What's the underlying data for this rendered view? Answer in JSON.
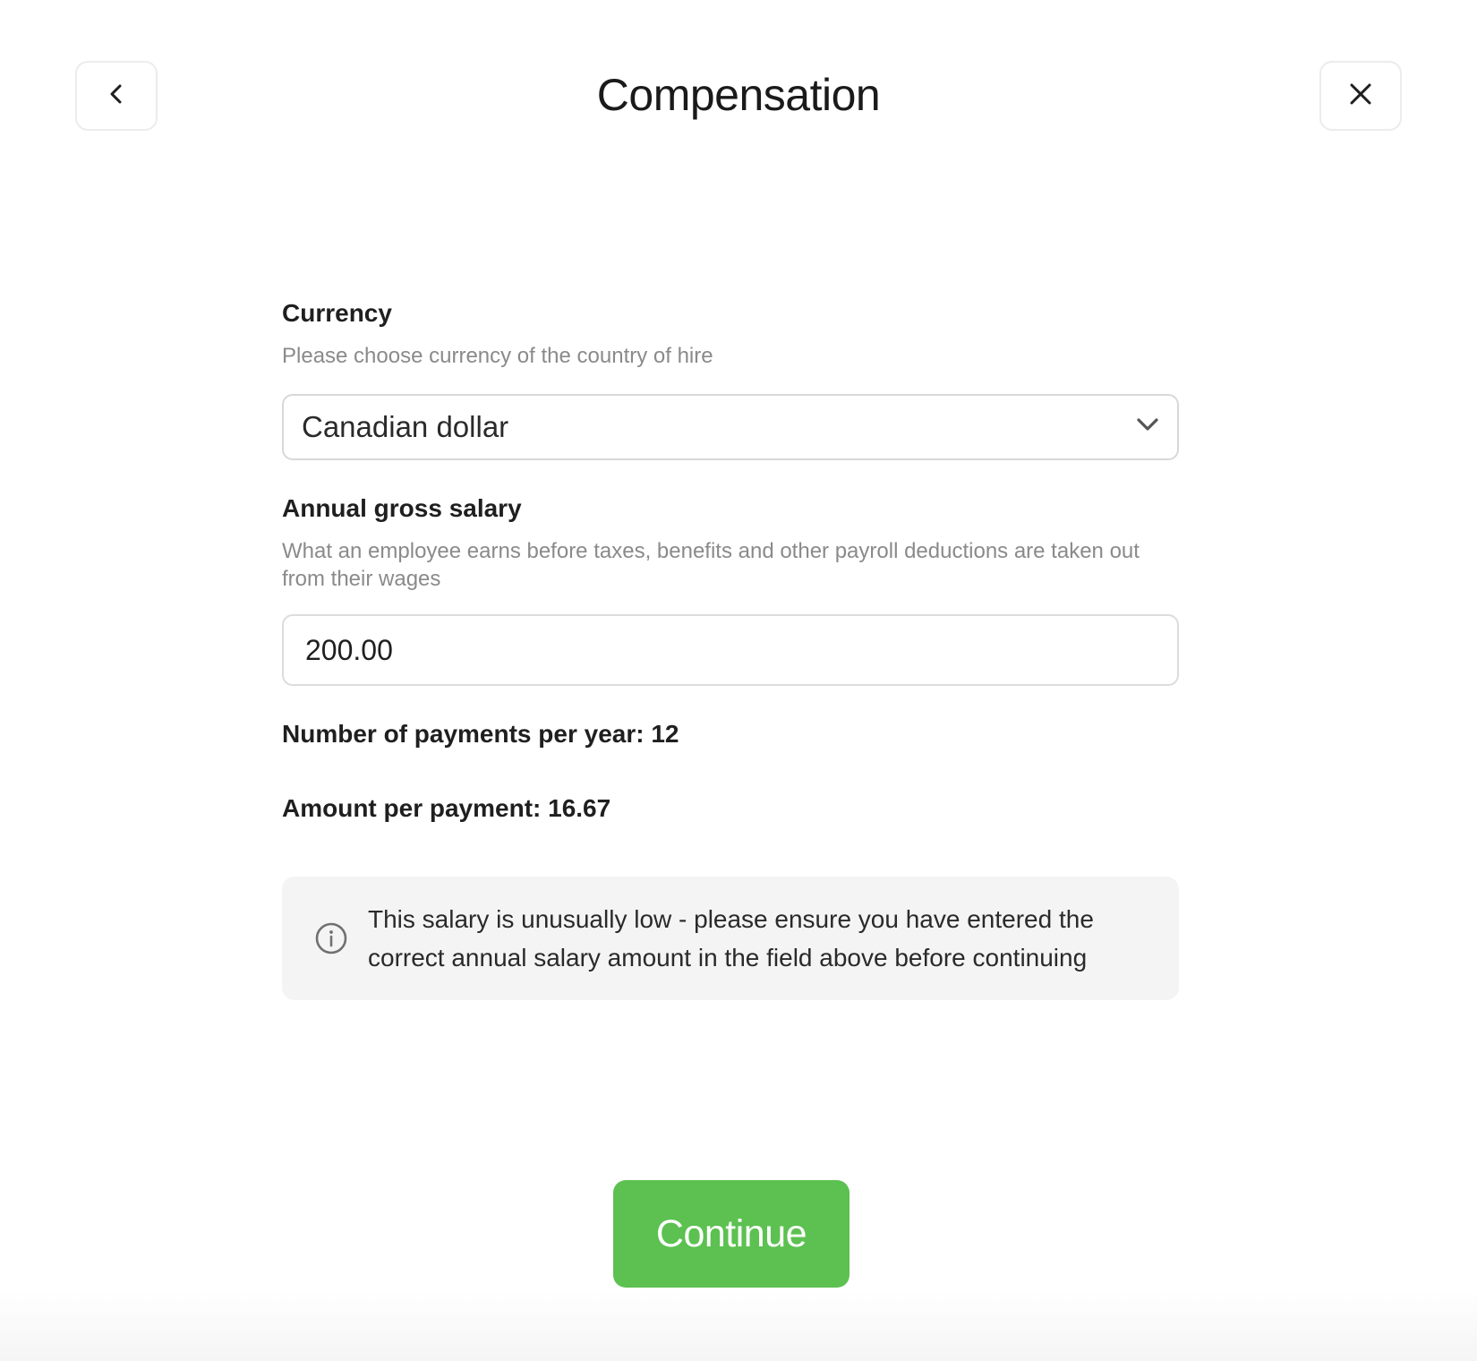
{
  "header": {
    "title": "Compensation",
    "back_icon": "chevron-left-icon",
    "close_icon": "close-icon"
  },
  "currency": {
    "label": "Currency",
    "help": "Please choose currency of the country of hire",
    "selected": "Canadian dollar",
    "dropdown_icon": "chevron-down-icon"
  },
  "salary": {
    "label": "Annual gross salary",
    "help": "What an employee earns before taxes, benefits and other payroll deductions are taken out from their wages",
    "value": "200.00"
  },
  "summary": {
    "payments_per_year": "Number of payments per year: 12",
    "amount_per_payment": "Amount per payment: 16.67"
  },
  "notice": {
    "icon": "info-icon",
    "text": "This salary is unusually low - please ensure you have entered the correct annual salary amount in the field above before continuing"
  },
  "actions": {
    "continue_label": "Continue"
  },
  "colors": {
    "primary": "#5cc150",
    "notice_bg": "#f4f4f4",
    "border": "#d8d8d8",
    "muted_text": "#8a8a8a"
  }
}
